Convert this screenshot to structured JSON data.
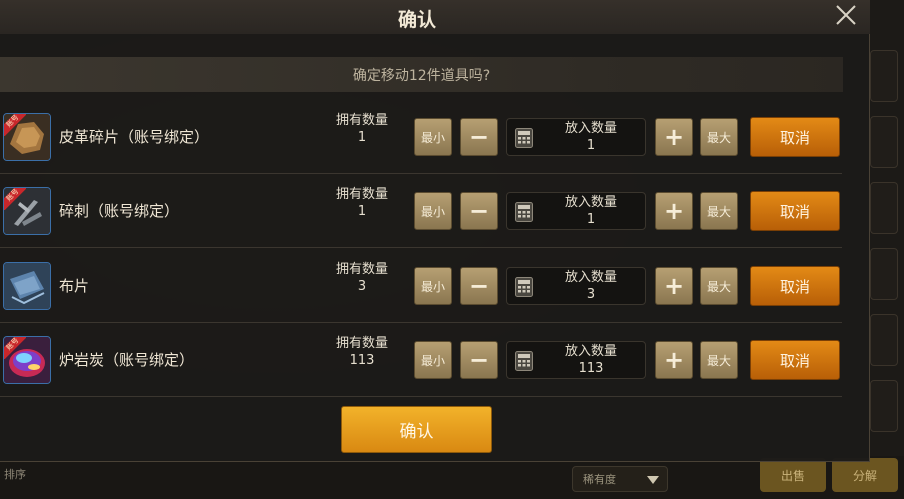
{
  "dialog": {
    "title": "确认",
    "prompt": "确定移动12件道具吗?",
    "confirm_label": "确认"
  },
  "labels": {
    "owned": "拥有数量",
    "put": "放入数量",
    "min": "最小",
    "max": "最大",
    "minus": "−",
    "plus": "+",
    "cancel": "取消",
    "bound_tag": "账号"
  },
  "items": [
    {
      "name": "皮革碎片（账号绑定）",
      "owned": "1",
      "put": "1",
      "icon": "leather-scrap-icon",
      "bound": true
    },
    {
      "name": "碎刺（账号绑定）",
      "owned": "1",
      "put": "1",
      "icon": "broken-thorn-icon",
      "bound": true
    },
    {
      "name": "布片",
      "owned": "3",
      "put": "3",
      "icon": "cloth-piece-icon",
      "bound": false
    },
    {
      "name": "炉岩炭（账号绑定）",
      "owned": "113",
      "put": "113",
      "icon": "furnace-coal-icon",
      "bound": true
    }
  ],
  "background": {
    "dropdown_value": "稀有度",
    "bottom_left_text": "排序",
    "sell_label": "出售",
    "split_label": "分解"
  },
  "colors": {
    "cancel_orange": "#c96d0c",
    "confirm_gold": "#e69d1c",
    "tan_button": "#a08b62",
    "icon_border_blue": "#3b6fa8"
  }
}
